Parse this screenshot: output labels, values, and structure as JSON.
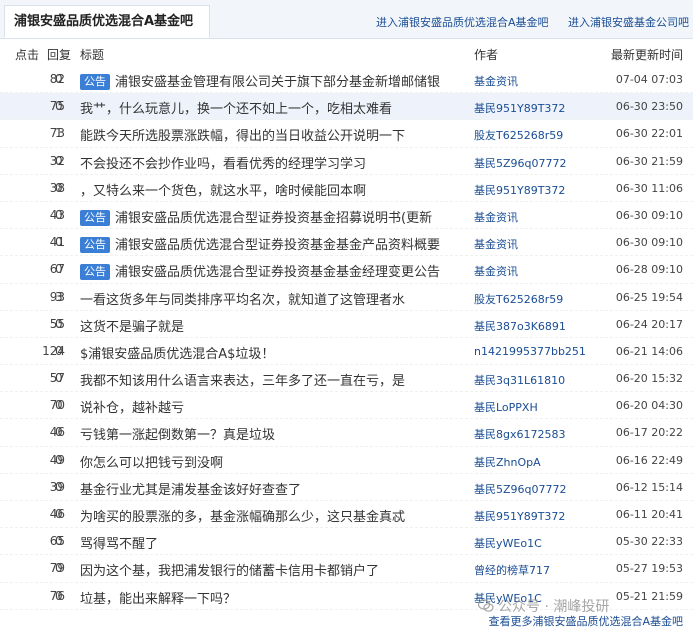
{
  "tabs": {
    "active": "浦银安盛品质优选混合A基金吧",
    "link1": "进入浦银安盛品质优选混合A基金吧",
    "link2": "进入浦银安盛基金公司吧"
  },
  "table": {
    "headers": {
      "clicks": "点击",
      "replies": "回复",
      "title": "标题",
      "author": "作者",
      "updated": "最新更新时间"
    },
    "badge_label": "公告",
    "rows": [
      {
        "clicks": "82",
        "replies": "0",
        "badge": true,
        "title": "浦银安盛基金管理有限公司关于旗下部分基金新增邮储银",
        "author": "基金资讯",
        "updated": "07-04 07:03"
      },
      {
        "clicks": "75",
        "replies": "0",
        "badge": false,
        "title": "我艹，什么玩意儿，换一个还不如上一个，吃相太难看",
        "author": "基民951Y89T372",
        "updated": "06-30 23:50",
        "highlight": true
      },
      {
        "clicks": "73",
        "replies": "1",
        "badge": false,
        "title": "能跌今天所选股票涨跌幅，得出的当日收益公开说明一下",
        "author": "股友T625268r59",
        "updated": "06-30 22:01"
      },
      {
        "clicks": "32",
        "replies": "0",
        "badge": false,
        "title": "不会投还不会抄作业吗，看看优秀的经理学习学习",
        "author": "基民5Z96q07772",
        "updated": "06-30 21:59"
      },
      {
        "clicks": "38",
        "replies": "0",
        "badge": false,
        "title": "，又特么来一个货色，就这水平，啥时候能回本啊",
        "author": "基民951Y89T372",
        "updated": "06-30 11:06"
      },
      {
        "clicks": "43",
        "replies": "0",
        "badge": true,
        "title": "浦银安盛品质优选混合型证券投资基金招募说明书(更新",
        "author": "基金资讯",
        "updated": "06-30 09:10"
      },
      {
        "clicks": "41",
        "replies": "0",
        "badge": true,
        "title": "浦银安盛品质优选混合型证券投资基金基金产品资料概要",
        "author": "基金资讯",
        "updated": "06-30 09:10"
      },
      {
        "clicks": "67",
        "replies": "0",
        "badge": true,
        "title": "浦银安盛品质优选混合型证券投资基金基金经理变更公告",
        "author": "基金资讯",
        "updated": "06-28 09:10"
      },
      {
        "clicks": "93",
        "replies": "3",
        "badge": false,
        "title": "一看这货多年与同类排序平均名次，就知道了这管理者水",
        "author": "股友T625268r59",
        "updated": "06-25 19:54"
      },
      {
        "clicks": "55",
        "replies": "0",
        "badge": false,
        "title": "这货不是骗子就是",
        "author": "基民387o3K6891",
        "updated": "06-24 20:17"
      },
      {
        "clicks": "124",
        "replies": "0",
        "badge": false,
        "title": "$浦银安盛品质优选混合A$垃圾！",
        "author": "n1421995377bb251",
        "updated": "06-21 14:06"
      },
      {
        "clicks": "57",
        "replies": "0",
        "badge": false,
        "title": "我都不知该用什么语言来表达，三年多了还一直在亏，是",
        "author": "基民3q31L61810",
        "updated": "06-20 15:32"
      },
      {
        "clicks": "70",
        "replies": "0",
        "badge": false,
        "title": "说补仓，越补越亏",
        "author": "基民LoPPXH",
        "updated": "06-20 04:30"
      },
      {
        "clicks": "46",
        "replies": "0",
        "badge": false,
        "title": "亏钱第一涨起倒数第一？真是垃圾",
        "author": "基民8gx6172583",
        "updated": "06-17 20:22"
      },
      {
        "clicks": "49",
        "replies": "0",
        "badge": false,
        "title": "你怎么可以把钱亏到没啊",
        "author": "基民ZhnOpA",
        "updated": "06-16 22:49"
      },
      {
        "clicks": "39",
        "replies": "0",
        "badge": false,
        "title": "基金行业尤其是浦发基金该好好查查了",
        "author": "基民5Z96q07772",
        "updated": "06-12 15:14"
      },
      {
        "clicks": "46",
        "replies": "0",
        "badge": false,
        "title": "为啥买的股票涨的多，基金涨幅确那么少，这只基金真忒",
        "author": "基民951Y89T372",
        "updated": "06-11 20:41"
      },
      {
        "clicks": "65",
        "replies": "0",
        "badge": false,
        "title": "骂得骂不醒了",
        "author": "基民yWEo1C",
        "updated": "05-30 22:33"
      },
      {
        "clicks": "79",
        "replies": "0",
        "badge": false,
        "title": "因为这个基，我把浦发银行的储蓄卡信用卡都销户了",
        "author": "曾经的榜草717",
        "updated": "05-27 19:53"
      },
      {
        "clicks": "76",
        "replies": "0",
        "badge": false,
        "title": "垃基，能出来解释一下吗？",
        "author": "基民yWEo1C",
        "updated": "05-21 21:59"
      }
    ]
  },
  "footer": {
    "more_link": "查看更多浦银安盛品质优选混合A基金吧"
  },
  "watermark": {
    "text": "公众号 · 潮峰投研"
  }
}
